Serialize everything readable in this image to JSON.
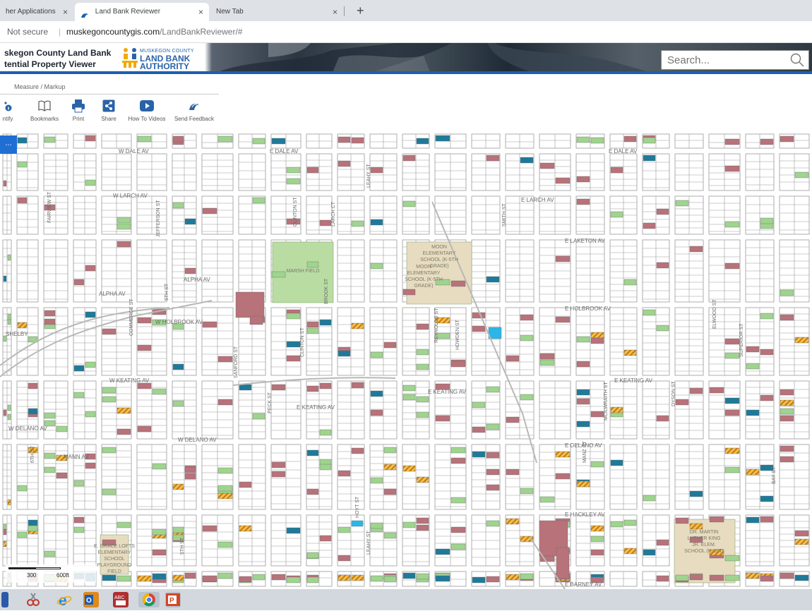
{
  "browser": {
    "tabs": [
      {
        "label": "her Applications",
        "active": false
      },
      {
        "label": "Land Bank Reviewer",
        "active": true
      },
      {
        "label": "New Tab",
        "active": false
      }
    ],
    "close_glyph": "×",
    "new_tab_glyph": "+",
    "security_label": "Not secure",
    "url_host": "muskegoncountygis.com",
    "url_path": "/LandBankReviewer/#"
  },
  "header": {
    "title_line1": "skegon County Land Bank",
    "title_line2": "tential Property Viewer",
    "logo_top": "MUSKEGON COUNTY",
    "logo_line1": "LAND BANK",
    "logo_line2": "AUTHORITY",
    "search_placeholder": "Search..."
  },
  "menu": {
    "label": "Measure / Markup"
  },
  "toolbar": [
    {
      "label": "ntify",
      "icon": "identify-icon"
    },
    {
      "label": "Bookmarks",
      "icon": "book-icon"
    },
    {
      "label": "Print",
      "icon": "printer-icon"
    },
    {
      "label": "Share",
      "icon": "share-icon"
    },
    {
      "label": "How To Videos",
      "icon": "video-play-icon"
    },
    {
      "label": "Send Feedback",
      "icon": "feedback-icon"
    }
  ],
  "map": {
    "button_label": "...",
    "streets_ew": [
      {
        "name": "W DALE AV"
      },
      {
        "name": "E DALE AV"
      },
      {
        "name": "E DALE AV"
      },
      {
        "name": "W LARCH AV"
      },
      {
        "name": "E LARCH AV"
      },
      {
        "name": "E LAKETON AV"
      },
      {
        "name": "ALPHA AV"
      },
      {
        "name": "ALPHA AV"
      },
      {
        "name": "E HOLBROOK AV"
      },
      {
        "name": "W HOLBROOK AV"
      },
      {
        "name": "W KEATING AV"
      },
      {
        "name": "E KEATING AV"
      },
      {
        "name": "E KEATING AV"
      },
      {
        "name": "E KEATING AV"
      },
      {
        "name": "W DELANO AV"
      },
      {
        "name": "W DELANO AV"
      },
      {
        "name": "E DELANO AV"
      },
      {
        "name": "MANN AV"
      },
      {
        "name": "E HACKLEY AV"
      },
      {
        "name": "E BARNEY AV"
      },
      {
        "name": "SHELBY"
      }
    ],
    "streets_ns": [
      {
        "name": "FAIRVIEW ST"
      },
      {
        "name": "JEFFERSON ST"
      },
      {
        "name": "5TH ST"
      },
      {
        "name": "COMMERCE ST"
      },
      {
        "name": "CLINTON ST"
      },
      {
        "name": "LARCH CT"
      },
      {
        "name": "LEAHY ST"
      },
      {
        "name": "SMITH ST"
      },
      {
        "name": "BROOK ST"
      },
      {
        "name": "CLINTON ST"
      },
      {
        "name": "REYNOLDS ST"
      },
      {
        "name": "HOWDEN ST"
      },
      {
        "name": "SANFORD ST"
      },
      {
        "name": "PECK ST"
      },
      {
        "name": "ELWOOD ST"
      },
      {
        "name": "SUPERIOR ST"
      },
      {
        "name": "DYSON ST"
      },
      {
        "name": "MCILWRAITH ST"
      },
      {
        "name": "MANZ ST"
      },
      {
        "name": "HOYT ST"
      },
      {
        "name": "LEAHY ST"
      },
      {
        "name": "6TH ST"
      },
      {
        "name": "5TH ST"
      },
      {
        "name": "BAY ST"
      }
    ],
    "place_labels": [
      {
        "text": "MARSH FIELD"
      },
      {
        "text": "MOON ELEMENTARY SCHOOL (K-5TH GRADE)"
      },
      {
        "text": "MOON ELEMENTARY SCHOOL (K-5TH GRADE)"
      },
      {
        "text": "E. GRACE LOFTS ELEMENTARY SCHOOL PLAYGROUND FIELD"
      },
      {
        "text": "DR. MARTIN LUTHER KING JR. ELEM. SCHOOL (K-1ST)"
      }
    ],
    "scale_300": "300",
    "scale_600": "600ft",
    "colors": {
      "parcel_outline": "#9a9a9a",
      "street": "#b8b8b8",
      "green_parcel": "#9fd48e",
      "red_parcel": "#b8727a",
      "blue_parcel": "#1f7a9a",
      "cyan_parcel": "#2bb6e8",
      "hatched_parcel": "#e8a020",
      "park": "#b9dca3",
      "school": "#e8dcc0"
    }
  },
  "taskbar": {
    "icons": [
      "windows-icon",
      "snipping-tool-icon",
      "ie-icon",
      "outlook-icon",
      "abc-icon",
      "chrome-icon",
      "powerpoint-icon"
    ]
  }
}
